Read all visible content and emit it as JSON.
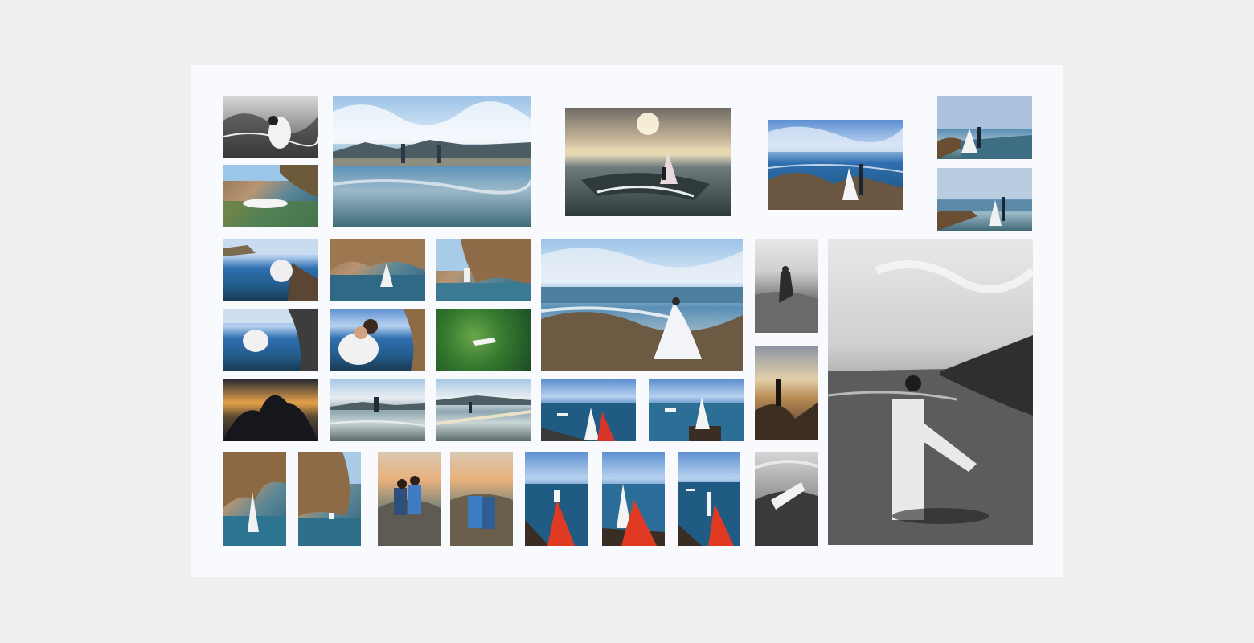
{
  "colors": {
    "page_background": "#efefef",
    "board_background": "#f9fafd"
  },
  "gallery": {
    "photos": [
      {
        "id": "p01",
        "subject": "couple-on-rocks-bw",
        "tone": "bw"
      },
      {
        "id": "p02",
        "subject": "couple-lying-in-tidepool",
        "tone": "rock"
      },
      {
        "id": "p03",
        "subject": "couple-on-reflective-flats",
        "tone": "sea"
      },
      {
        "id": "p04",
        "subject": "proposal-on-rock-at-sunset",
        "tone": "sunset"
      },
      {
        "id": "p05",
        "subject": "couple-on-rocky-shore",
        "tone": "blue"
      },
      {
        "id": "p06",
        "subject": "couple-on-rocks-by-sea",
        "tone": "sea"
      },
      {
        "id": "p07",
        "subject": "bride-on-rocks-by-sea",
        "tone": "sea"
      },
      {
        "id": "p08",
        "subject": "couple-in-water-by-rocks",
        "tone": "blue"
      },
      {
        "id": "p09",
        "subject": "couple-in-cave-water",
        "tone": "rock"
      },
      {
        "id": "p10",
        "subject": "groom-in-cave-water",
        "tone": "rock"
      },
      {
        "id": "p11",
        "subject": "bride-on-rocks-waves",
        "tone": "sea"
      },
      {
        "id": "p12",
        "subject": "couple-silhouette-bw",
        "tone": "bwsky"
      },
      {
        "id": "p13",
        "subject": "couple-kiss-bw-large",
        "tone": "bwsky"
      },
      {
        "id": "p14",
        "subject": "couple-in-water-blue",
        "tone": "blue"
      },
      {
        "id": "p15",
        "subject": "couple-close-up-water",
        "tone": "blue"
      },
      {
        "id": "p16",
        "subject": "figure-floating-green-water",
        "tone": "green"
      },
      {
        "id": "p17",
        "subject": "couple-silhouette-sunset",
        "tone": "tea"
      },
      {
        "id": "p18",
        "subject": "couple-dusk-close",
        "tone": "dusk"
      },
      {
        "id": "p19",
        "subject": "couple-on-flats-calm",
        "tone": "calm"
      },
      {
        "id": "p20",
        "subject": "couple-walking-flats",
        "tone": "calm"
      },
      {
        "id": "p21",
        "subject": "couple-on-dock-blue",
        "tone": "blue"
      },
      {
        "id": "p22",
        "subject": "groom-on-dock",
        "tone": "blue"
      },
      {
        "id": "p23",
        "subject": "groom-in-cave",
        "tone": "rock"
      },
      {
        "id": "p24",
        "subject": "cave-water-couple",
        "tone": "rock"
      },
      {
        "id": "p25",
        "subject": "couple-sitting-rocks",
        "tone": "warm"
      },
      {
        "id": "p26",
        "subject": "couple-embrace-sunset-rocks",
        "tone": "warm"
      },
      {
        "id": "p27",
        "subject": "bride-red-dress-dock",
        "tone": "blue"
      },
      {
        "id": "p28",
        "subject": "couple-red-dress-dock",
        "tone": "blue"
      },
      {
        "id": "p29",
        "subject": "couple-red-dress-dock-wide",
        "tone": "blue"
      },
      {
        "id": "p30",
        "subject": "couple-lying-water-bw",
        "tone": "bw"
      }
    ]
  }
}
